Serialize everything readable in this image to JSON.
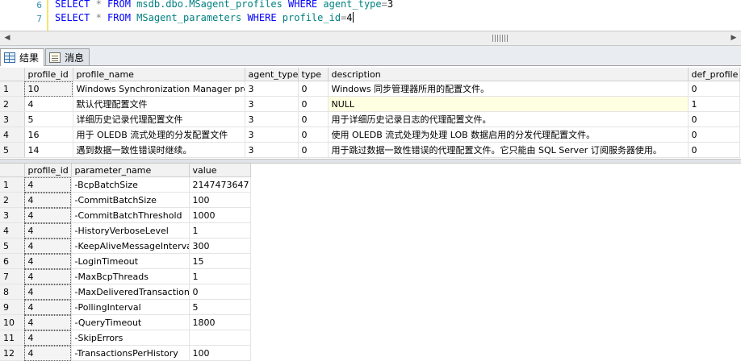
{
  "editor": {
    "lines": [
      {
        "num": "6",
        "tokens": [
          {
            "t": "SELECT",
            "c": "kw"
          },
          {
            "t": " * ",
            "c": "op"
          },
          {
            "t": "FROM",
            "c": "kw"
          },
          {
            "t": " msdb.dbo.MSagent_profiles ",
            "c": "id"
          },
          {
            "t": "WHERE",
            "c": "kw"
          },
          {
            "t": " agent_type",
            "c": "id"
          },
          {
            "t": "=",
            "c": "op"
          },
          {
            "t": "3",
            "c": "lit"
          }
        ]
      },
      {
        "num": "7",
        "tokens": [
          {
            "t": "SELECT",
            "c": "kw"
          },
          {
            "t": " * ",
            "c": "op"
          },
          {
            "t": "FROM",
            "c": "kw"
          },
          {
            "t": " MSagent_parameters ",
            "c": "id"
          },
          {
            "t": "WHERE",
            "c": "kw"
          },
          {
            "t": " profile_id",
            "c": "id"
          },
          {
            "t": "=",
            "c": "op"
          },
          {
            "t": "4",
            "c": "lit"
          }
        ]
      }
    ]
  },
  "tabs": [
    {
      "label": "结果",
      "icon": "grid-icon"
    },
    {
      "label": "消息",
      "icon": "message-icon"
    }
  ],
  "grid1": {
    "columns": [
      "profile_id",
      "profile_name",
      "agent_type",
      "type",
      "description",
      "def_profile"
    ],
    "rows": [
      [
        "1",
        "10",
        "Windows Synchronization Manager profile",
        "3",
        "0",
        "Windows 同步管理器所用的配置文件。",
        "0"
      ],
      [
        "2",
        "4",
        "默认代理配置文件",
        "3",
        "0",
        "NULL",
        "1"
      ],
      [
        "3",
        "5",
        "详细历史记录代理配置文件",
        "3",
        "0",
        "用于详细历史记录日志的代理配置文件。",
        "0"
      ],
      [
        "4",
        "16",
        "用于 OLEDB 流式处理的分发配置文件",
        "3",
        "0",
        "使用 OLEDB 流式处理为处理 LOB 数据启用的分发代理配置文件。",
        "0"
      ],
      [
        "5",
        "14",
        "遇到数据一致性错误时继续。",
        "3",
        "0",
        "用于跳过数据一致性错误的代理配置文件。它只能由 SQL Server 订阅服务器使用。",
        "0"
      ]
    ]
  },
  "grid2": {
    "columns": [
      "profile_id",
      "parameter_name",
      "value"
    ],
    "rows": [
      [
        "1",
        "4",
        "-BcpBatchSize",
        "2147473647"
      ],
      [
        "2",
        "4",
        "-CommitBatchSize",
        "100"
      ],
      [
        "3",
        "4",
        "-CommitBatchThreshold",
        "1000"
      ],
      [
        "4",
        "4",
        "-HistoryVerboseLevel",
        "1"
      ],
      [
        "5",
        "4",
        "-KeepAliveMessageInterval",
        "300"
      ],
      [
        "6",
        "4",
        "-LoginTimeout",
        "15"
      ],
      [
        "7",
        "4",
        "-MaxBcpThreads",
        "1"
      ],
      [
        "8",
        "4",
        "-MaxDeliveredTransactions",
        "0"
      ],
      [
        "9",
        "4",
        "-PollingInterval",
        "5"
      ],
      [
        "10",
        "4",
        "-QueryTimeout",
        "1800"
      ],
      [
        "11",
        "4",
        "-SkipErrors",
        ""
      ],
      [
        "12",
        "4",
        "-TransactionsPerHistory",
        "100"
      ]
    ]
  },
  "colors": {
    "keyword": "#0000ff",
    "identifier": "#008080",
    "operator": "#808080",
    "line_number": "#2b91af"
  }
}
